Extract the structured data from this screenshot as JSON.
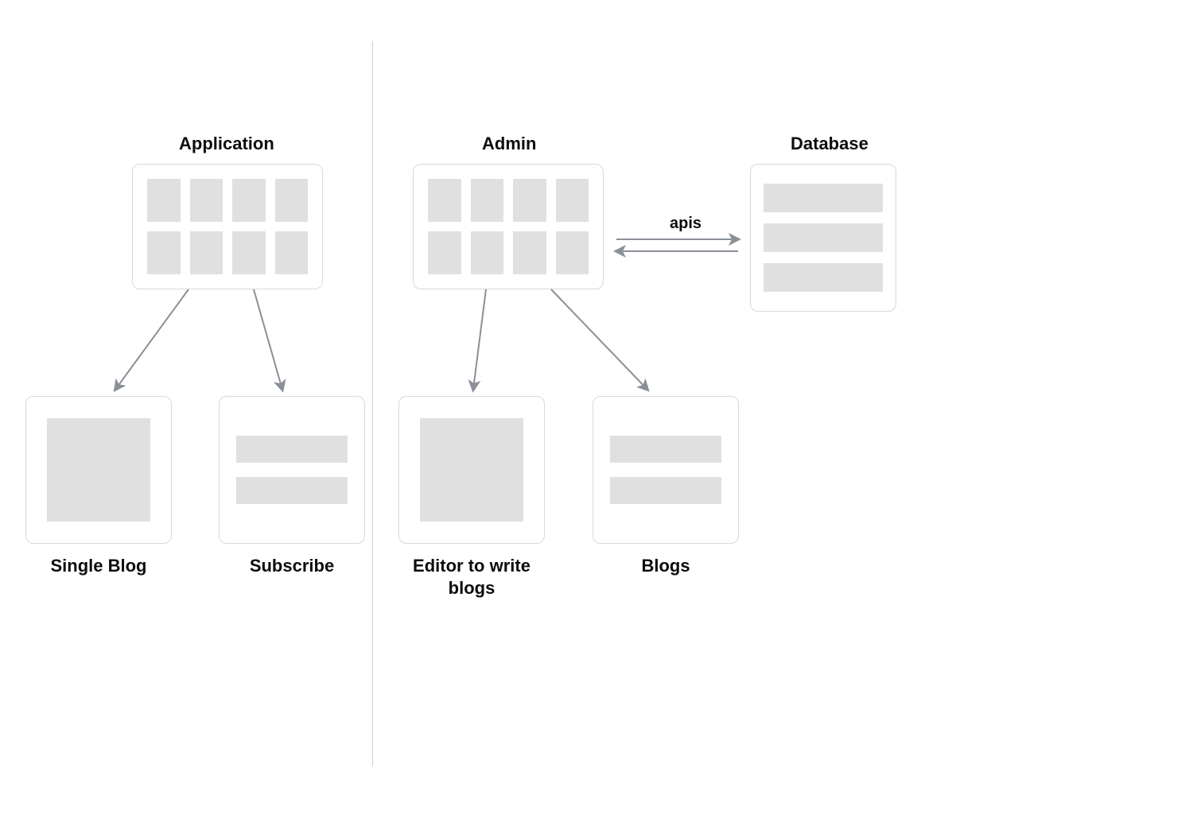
{
  "sections": {
    "application": {
      "title": "Application"
    },
    "admin": {
      "title": "Admin"
    },
    "database": {
      "title": "Database"
    }
  },
  "children": {
    "single_blog": {
      "label": "Single Blog"
    },
    "subscribe": {
      "label": "Subscribe"
    },
    "editor": {
      "label": "Editor to write blogs"
    },
    "blogs": {
      "label": "Blogs"
    }
  },
  "connectors": {
    "apis": {
      "label": "apis"
    }
  }
}
